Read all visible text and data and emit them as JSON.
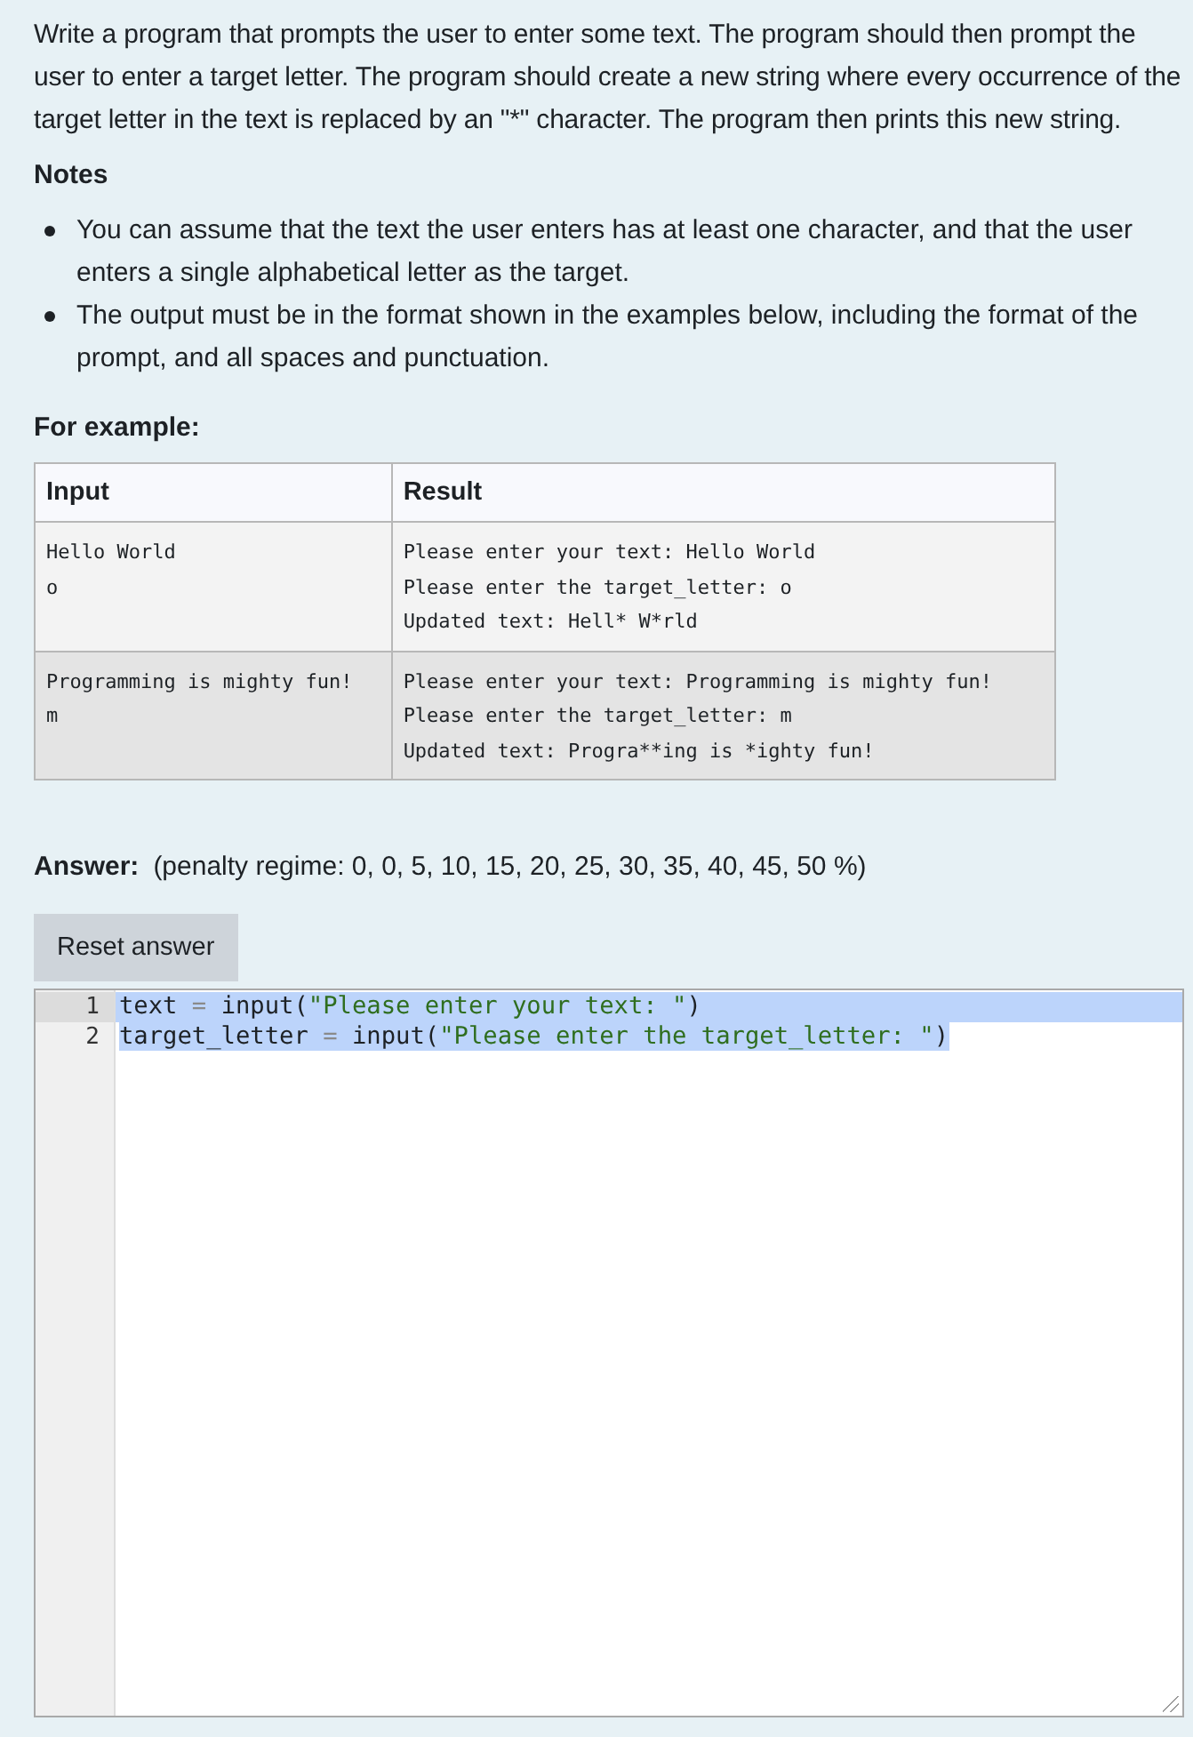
{
  "question": {
    "text": "Write a program that prompts the user to enter some text. The program should then prompt the user to enter a target letter. The program should create a new string where every occurrence of the target letter in the text is replaced by an \"*\" character. The program then prints this new string.",
    "notes_heading": "Notes",
    "notes": [
      "You can assume that the text the user enters has at least one character, and that the user enters a single alphabetical letter as the target.",
      "The output must be in the format shown in the examples below, including the format of the prompt, and all spaces and punctuation."
    ]
  },
  "examples": {
    "heading": "For example:",
    "columns": [
      "Input",
      "Result"
    ],
    "rows": [
      {
        "input": [
          "Hello World",
          "o"
        ],
        "result": [
          "Please enter your text: Hello World",
          "Please enter the target_letter: o",
          "Updated text: Hell* W*rld"
        ]
      },
      {
        "input": [
          "Programming is mighty fun!",
          "m"
        ],
        "result": [
          "Please enter your text: Programming is mighty fun!",
          "Please enter the target_letter: m",
          "Updated text: Progra**ing is *ighty fun!"
        ]
      }
    ]
  },
  "answer": {
    "label": "Answer:",
    "penalty": "(penalty regime: 0, 0, 5, 10, 15, 20, 25, 30, 35, 40, 45, 50 %)",
    "reset_button": "Reset answer"
  },
  "editor": {
    "lines": [
      {
        "number": "1",
        "selected": true,
        "tokens": [
          {
            "kind": "name",
            "text": "text"
          },
          {
            "kind": "op",
            "text": " = "
          },
          {
            "kind": "name",
            "text": "input("
          },
          {
            "kind": "str",
            "text": "\"Please enter your text: \""
          },
          {
            "kind": "name",
            "text": ")"
          }
        ]
      },
      {
        "number": "2",
        "selected": true,
        "tokens": [
          {
            "kind": "name",
            "text": "target_letter"
          },
          {
            "kind": "op",
            "text": " = "
          },
          {
            "kind": "name",
            "text": "input("
          },
          {
            "kind": "str",
            "text": "\"Please enter the target_letter: \""
          },
          {
            "kind": "name",
            "text": ")"
          }
        ]
      }
    ]
  }
}
